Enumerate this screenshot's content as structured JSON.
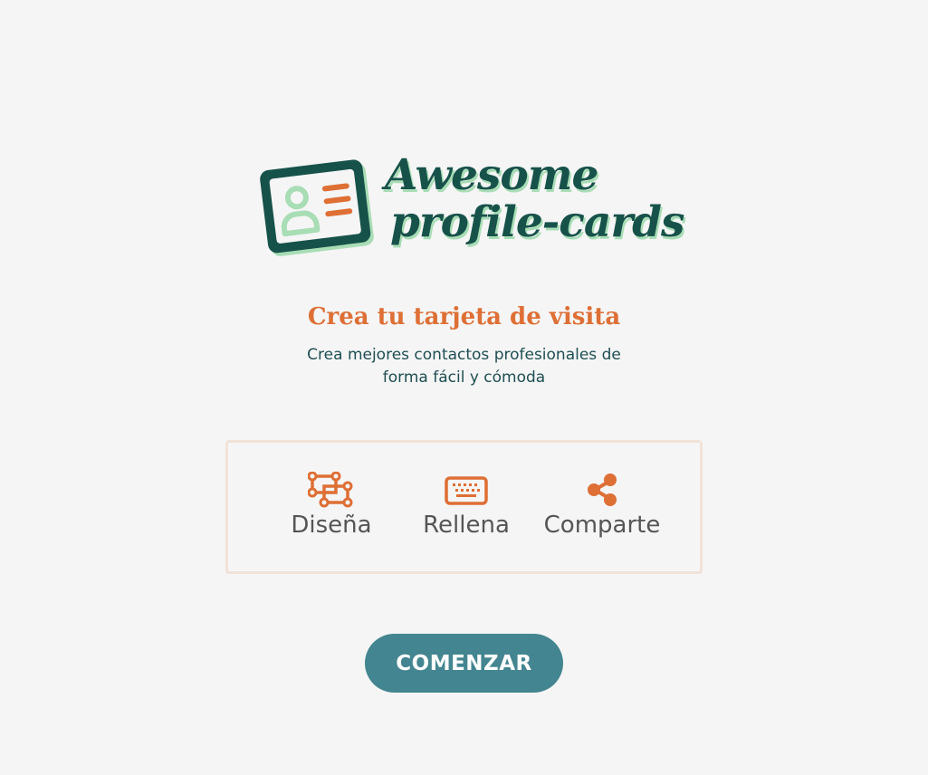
{
  "brand": {
    "name_line1": "Awesome",
    "name_line2": "profile-cards",
    "logo_icon": "id-card-icon",
    "colors": {
      "dark_green": "#17524a",
      "mint": "#a8ddb5",
      "orange": "#de6f35"
    }
  },
  "hero": {
    "headline": "Crea tu tarjeta de visita",
    "subtitle": "Crea mejores contactos profesionales de forma fácil y cómoda"
  },
  "features": [
    {
      "label": "Diseña",
      "icon": "vector-shape-icon"
    },
    {
      "label": "Rellena",
      "icon": "keyboard-icon"
    },
    {
      "label": "Comparte",
      "icon": "share-icon"
    }
  ],
  "cta": {
    "label": "COMENZAR",
    "color": "#438590"
  },
  "page": {
    "background": "#f5f5f5"
  }
}
